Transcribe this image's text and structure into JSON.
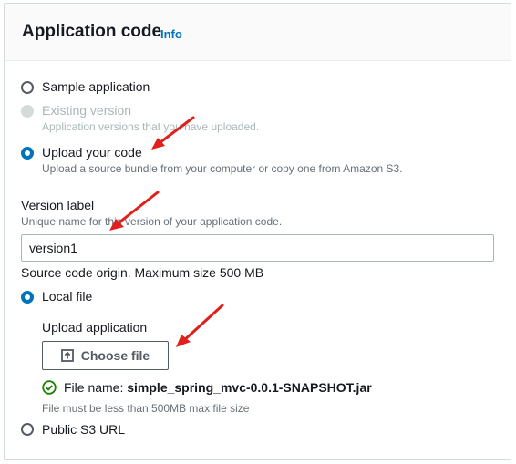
{
  "header": {
    "title": "Application code",
    "info": "Info"
  },
  "options": {
    "sample": {
      "label": "Sample application"
    },
    "existing": {
      "label": "Existing version",
      "desc": "Application versions that you have uploaded."
    },
    "upload": {
      "label": "Upload your code",
      "desc": "Upload a source bundle from your computer or copy one from Amazon S3."
    }
  },
  "version": {
    "label": "Version label",
    "desc": "Unique name for this version of your application code.",
    "value": "version1"
  },
  "origin": {
    "label": "Source code origin. Maximum size 500 MB"
  },
  "local": {
    "label": "Local file"
  },
  "uploadApp": {
    "label": "Upload application",
    "button": "Choose file"
  },
  "file": {
    "prefix": "File name: ",
    "name": "simple_spring_mvc-0.0.1-SNAPSHOT.jar",
    "hint": "File must be less than 500MB max file size"
  },
  "s3": {
    "label": "Public S3 URL"
  },
  "colors": {
    "accent": "#0073bb",
    "success": "#1d8102",
    "annotation": "#e0201c"
  },
  "icons": [
    "upload-icon",
    "check-circle-icon",
    "arrow-icon"
  ]
}
